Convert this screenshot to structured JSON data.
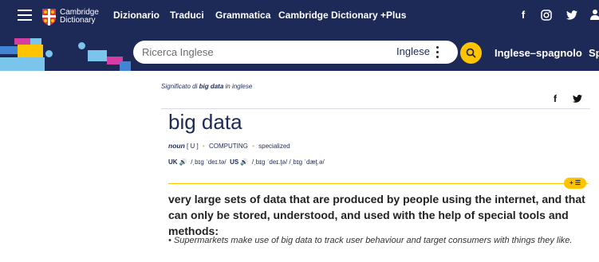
{
  "header": {
    "logo_line1": "Cambridge",
    "logo_line2": "Dictionary",
    "nav": [
      "Dizionario",
      "Traduci",
      "Grammatica",
      "Cambridge Dictionary +Plus"
    ],
    "social_icons": [
      "facebook-icon",
      "instagram-icon",
      "twitter-icon"
    ]
  },
  "search": {
    "placeholder": "Ricerca Inglese",
    "language": "Inglese",
    "dictionary_title": "Inglese–spagnolo",
    "dictionary_title_next": "Sp"
  },
  "entry": {
    "meaning_prefix": "Significato di ",
    "meaning_term": "big data",
    "meaning_suffix": " in inglese",
    "headword": "big data",
    "pos": "noun",
    "grammar": "[ U ]",
    "domain": "COMPUTING",
    "register": "specialized",
    "uk_label": "UK",
    "uk_ipa": "/ˌbɪɡ ˈdeɪ.tə/",
    "us_label": "US",
    "us_ipa1": "/ˌbɪɡ ˈdeɪ.t̬ə/",
    "us_ipa2": "/ˌbɪɡ ˈdæt̬.ə/",
    "add_to_list": "+ ☰",
    "definition": "very large sets of data that are produced by people using the internet, and that can only be stored, understood, and used with the help of special tools and methods:",
    "example": "• Supermarkets make use of big data to track user behaviour and target consumers with things they like."
  },
  "colors": {
    "brand_navy": "#1d2a57",
    "accent_yellow": "#fec400"
  }
}
